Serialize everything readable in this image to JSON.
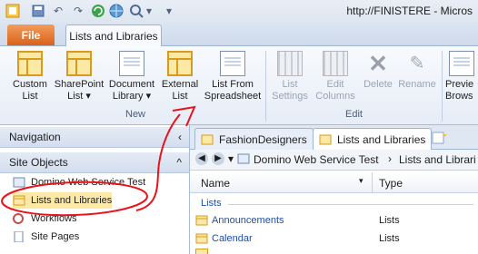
{
  "window": {
    "title": "http://FINISTERE - Micros"
  },
  "tabs": {
    "file": "File",
    "active": "Lists and Libraries"
  },
  "ribbon": {
    "new_group": {
      "label": "New",
      "buttons": [
        {
          "line1": "Custom",
          "line2": "List"
        },
        {
          "line1": "SharePoint",
          "line2": "List ▾"
        },
        {
          "line1": "Document",
          "line2": "Library ▾"
        },
        {
          "line1": "External",
          "line2": "List"
        },
        {
          "line1": "List From",
          "line2": "Spreadsheet"
        }
      ]
    },
    "edit_group": {
      "label": "Edit",
      "buttons": [
        {
          "line1": "List",
          "line2": "Settings"
        },
        {
          "line1": "Edit",
          "line2": "Columns"
        },
        {
          "line1": "Delete",
          "line2": ""
        },
        {
          "line1": "Rename",
          "line2": ""
        }
      ]
    },
    "extra": {
      "line1": "Previe",
      "line2": "Brows"
    }
  },
  "navigation": {
    "header": "Navigation",
    "site_objects_header": "Site Objects",
    "items": [
      {
        "label": "Domino Web Service Test"
      },
      {
        "label": "Lists and Libraries"
      },
      {
        "label": "Workflows"
      },
      {
        "label": "Site Pages"
      }
    ]
  },
  "doc_tabs": [
    {
      "label": "FashionDesigners"
    },
    {
      "label": "Lists and Libraries"
    }
  ],
  "breadcrumb": {
    "site": "Domino Web Service Test",
    "page": "Lists and Librari"
  },
  "columns": {
    "name": "Name",
    "type": "Type"
  },
  "list": {
    "section": "Lists",
    "rows": [
      {
        "name": "Announcements",
        "type": "Lists"
      },
      {
        "name": "Calendar",
        "type": "Lists"
      }
    ]
  },
  "colors": {
    "annotation": "#e8131b",
    "file_tab": "#e36c1e",
    "link": "#1f4ea6"
  }
}
